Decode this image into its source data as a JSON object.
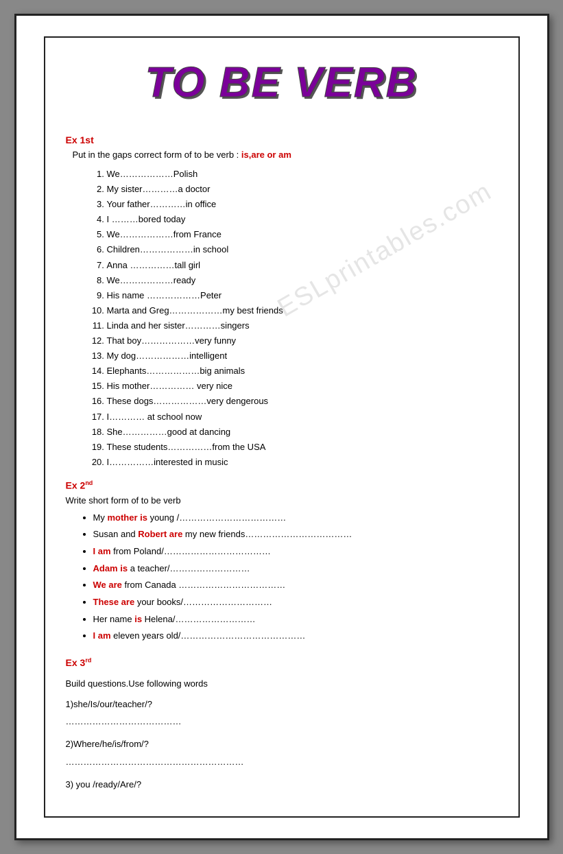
{
  "title": "TO BE VERB",
  "watermark": "ESLprintables.com",
  "ex1": {
    "label": "Ex 1st",
    "instruction_plain": "Put  in the gaps   correct form of to be verb : ",
    "instruction_highlight": "is,are or am",
    "items": [
      "We………………Polish",
      "My sister…………a doctor",
      "Your father…………in office",
      "I ………bored today",
      "We………………from France",
      "Children………………in school",
      "Anna ……………tall girl",
      "We………………ready",
      "His name ………………Peter",
      "Marta and Greg………………my best friends",
      "Linda and her sister…………singers",
      "That boy………………very funny",
      "My dog………………intelligent",
      "Elephants………………big animals",
      "His mother…………… very nice",
      "These dogs……………very dengerous",
      "I………… at school now",
      "She……………good at dancing",
      "These students……………from the USA",
      "I……………interested in music"
    ]
  },
  "ex2": {
    "label": "Ex 2",
    "superscript": "nd",
    "instruction": "Write short form of to be verb",
    "items": [
      {
        "plain_before": "My ",
        "red": "mother is",
        "plain_after": " young /………………………………"
      },
      {
        "plain_before": "Susan  and ",
        "red": "Robert are",
        "plain_after": " my new friends………………………………"
      },
      {
        "plain_before": "",
        "red": "I am",
        "plain_after": " from Poland/………………………………"
      },
      {
        "plain_before": "",
        "red": "Adam is",
        "plain_after": " a teacher/………………………"
      },
      {
        "plain_before": "",
        "red": "We are",
        "plain_after": " from Canada ………………………………"
      },
      {
        "plain_before": "",
        "red": "These are",
        "plain_after": " your books/…………………………"
      },
      {
        "plain_before": "Her name ",
        "red": "is",
        "plain_after": " Helena/………………………"
      },
      {
        "plain_before": "",
        "red": "I am",
        "plain_after": " eleven years old/……………………………………"
      }
    ]
  },
  "ex3": {
    "label": "Ex 3",
    "superscript": "rd",
    "instruction": "Build questions.Use  following words",
    "questions": [
      {
        "q": "1)she/Is/our/teacher/?",
        "answer_line": "…………………………………"
      },
      {
        "q": "2)Where/he/is/from/?",
        "answer_line": "……………………………………………………"
      },
      {
        "q": "3) you /ready/Are/?",
        "answer_line": ""
      }
    ]
  }
}
